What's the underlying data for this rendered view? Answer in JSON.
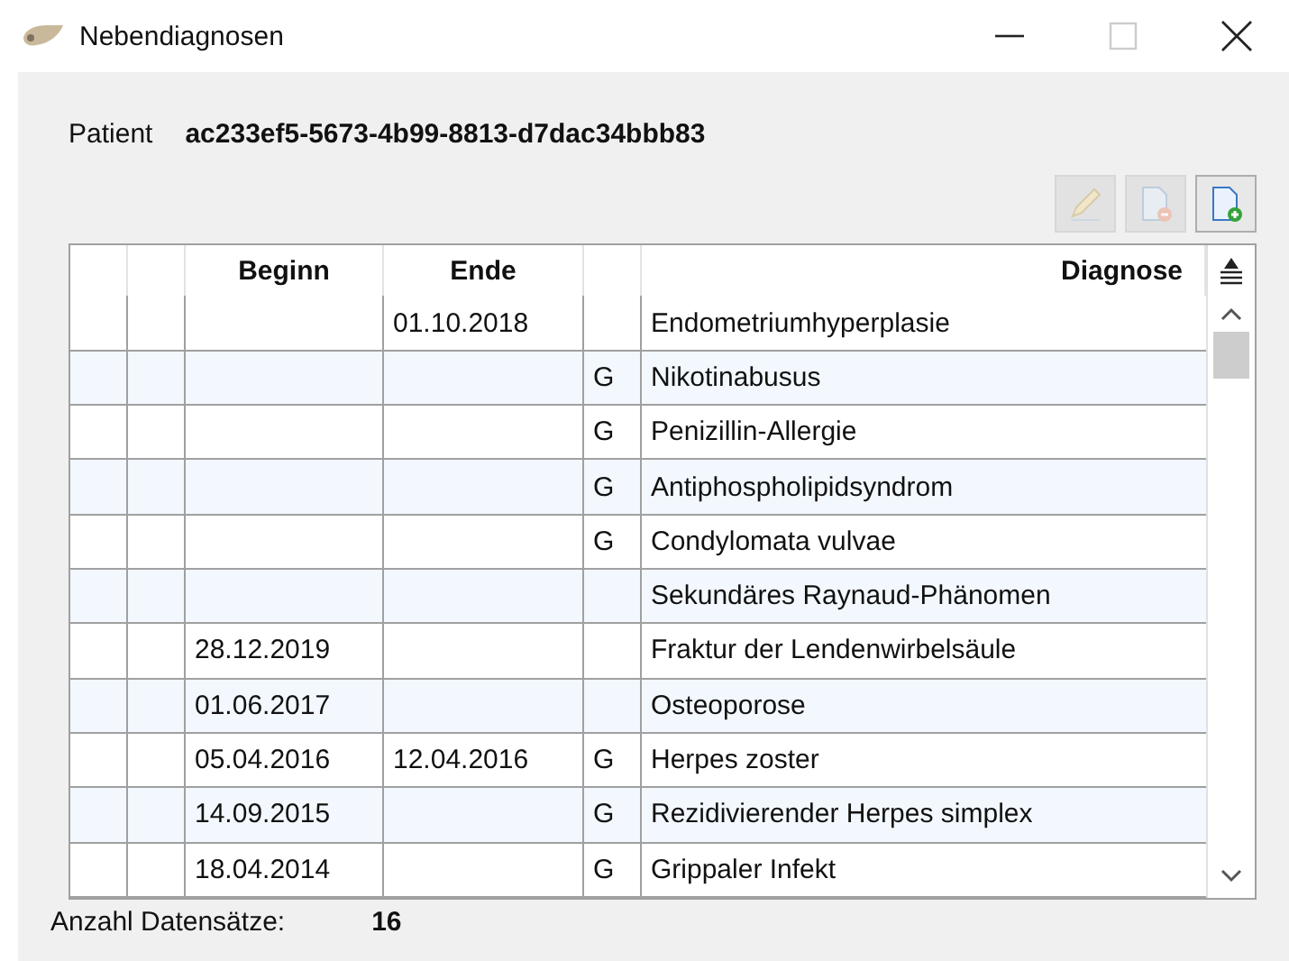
{
  "window": {
    "title": "Nebendiagnosen"
  },
  "patient": {
    "label": "Patient",
    "value": "ac233ef5-5673-4b99-8813-d7dac34bbb83"
  },
  "toolbar": [
    {
      "kind": "edit",
      "disabled": true
    },
    {
      "kind": "remove",
      "disabled": true
    },
    {
      "kind": "add",
      "disabled": false
    }
  ],
  "table": {
    "columns": [
      "Beginn",
      "Ende",
      "Diagnose"
    ],
    "rows": [
      {
        "beginn": "",
        "ende": "01.10.2018",
        "flag": "",
        "diagnose": "Endometriumhyperplasie"
      },
      {
        "beginn": "",
        "ende": "",
        "flag": "G",
        "diagnose": "Nikotinabusus"
      },
      {
        "beginn": "",
        "ende": "",
        "flag": "G",
        "diagnose": "Penizillin-Allergie"
      },
      {
        "beginn": "",
        "ende": "",
        "flag": "G",
        "diagnose": "Antiphospholipidsyndrom"
      },
      {
        "beginn": "",
        "ende": "",
        "flag": "G",
        "diagnose": "Condylomata vulvae"
      },
      {
        "beginn": "",
        "ende": "",
        "flag": "",
        "diagnose": "Sekundäres Raynaud-Phänomen"
      },
      {
        "beginn": "28.12.2019",
        "ende": "",
        "flag": "",
        "diagnose": "Fraktur der Lendenwirbelsäule"
      },
      {
        "beginn": "01.06.2017",
        "ende": "",
        "flag": "",
        "diagnose": "Osteoporose"
      },
      {
        "beginn": "05.04.2016",
        "ende": "12.04.2016",
        "flag": "G",
        "diagnose": "Herpes zoster"
      },
      {
        "beginn": "14.09.2015",
        "ende": "",
        "flag": "G",
        "diagnose": "Rezidivierender Herpes simplex"
      },
      {
        "beginn": "18.04.2014",
        "ende": "",
        "flag": "G",
        "diagnose": "Grippaler Infekt"
      }
    ]
  },
  "footer": {
    "label": "Anzahl Datensätze:",
    "value": "16"
  }
}
